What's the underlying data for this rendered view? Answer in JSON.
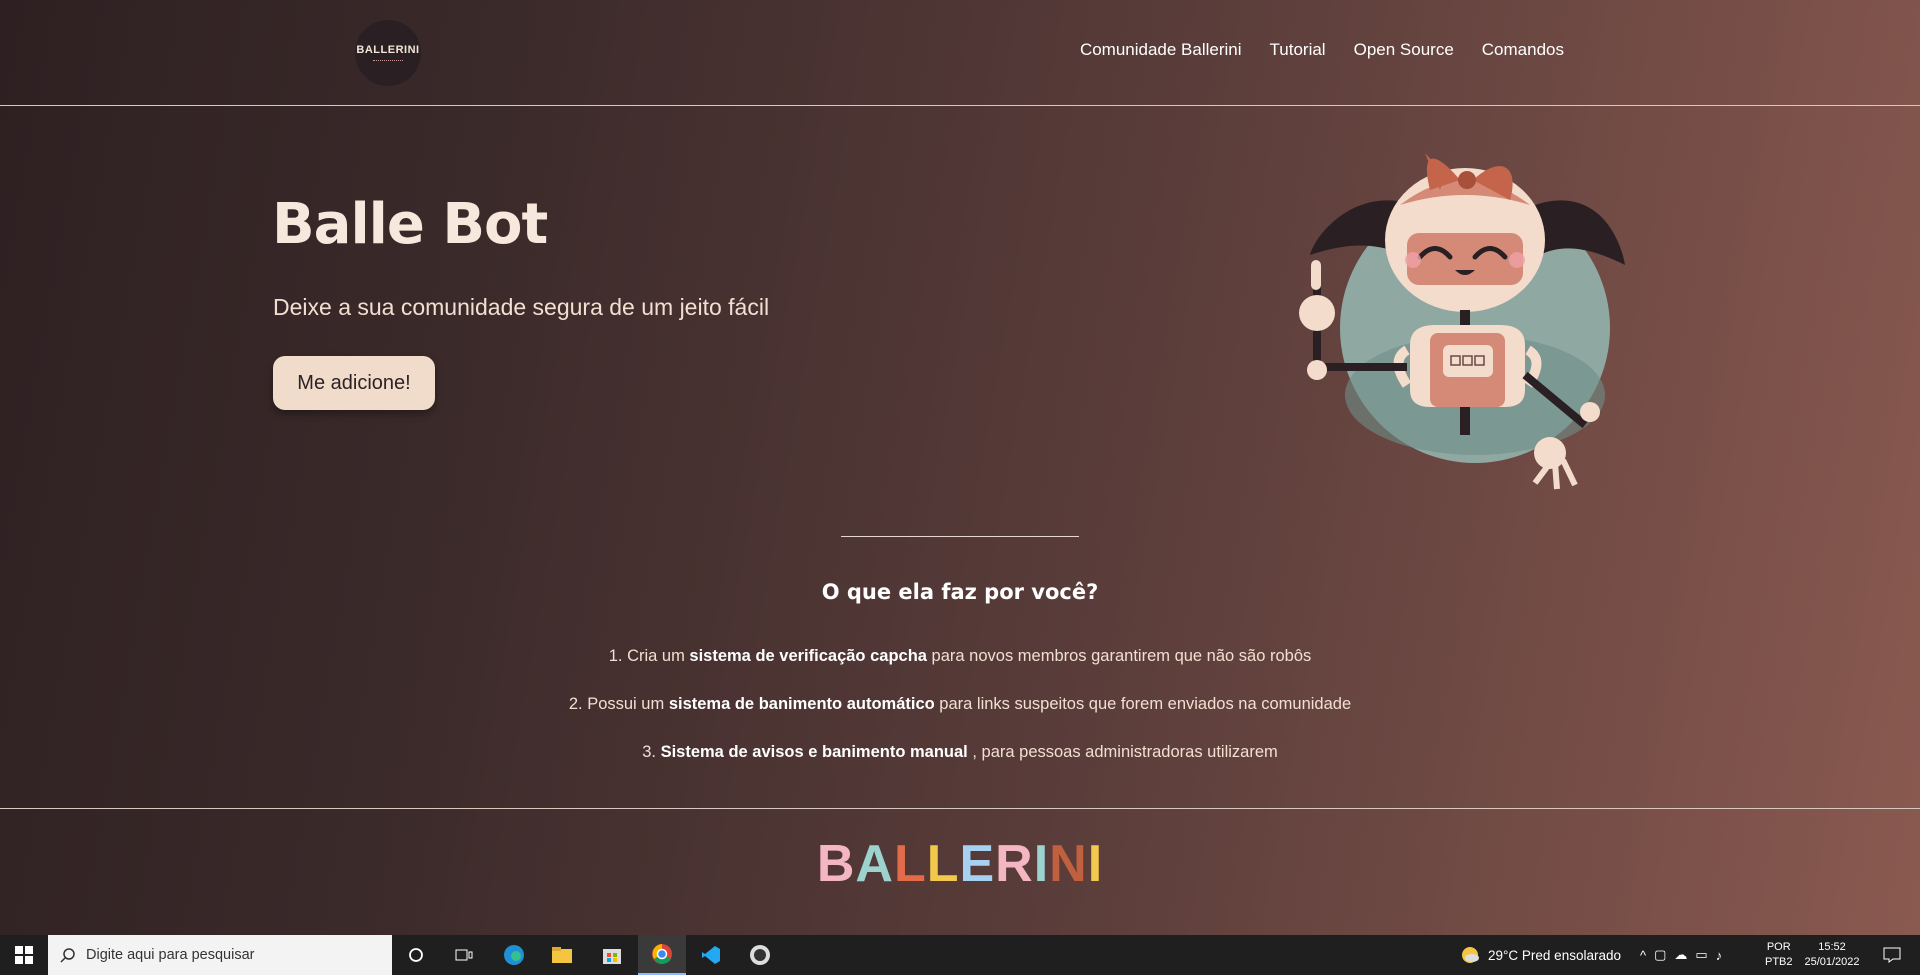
{
  "logo": {
    "text": "BALLERINI"
  },
  "nav": {
    "items": [
      "Comunidade Ballerini",
      "Tutorial",
      "Open Source",
      "Comandos"
    ]
  },
  "hero": {
    "title": "Balle Bot",
    "subtitle": "Deixe a sua comunidade segura de um jeito fácil",
    "button": "Me adicione!"
  },
  "features": {
    "title": "O que ela faz por você?",
    "items": [
      {
        "pre": "1. Cria um ",
        "bold": "sistema de verificação capcha",
        "post": " para novos membros garantirem que não são robôs"
      },
      {
        "pre": "2. Possui um ",
        "bold": "sistema de banimento automático",
        "post": " para links suspeitos que forem enviados na comunidade"
      },
      {
        "pre": "3. ",
        "bold": "Sistema de avisos e banimento manual",
        "post": " , para pessoas administradoras utilizarem"
      }
    ]
  },
  "footer": {
    "brand_letters": [
      "B",
      "A",
      "L",
      "L",
      "E",
      "R",
      "I",
      "N",
      "I"
    ],
    "brand_colors": [
      "#f4b6c2",
      "#9dd3cf",
      "#e36b4a",
      "#f2c94c",
      "#a6d1f0",
      "#f4b6c2",
      "#9dd3cf",
      "#c0603f",
      "#f2c94c"
    ]
  },
  "taskbar": {
    "search_placeholder": "Digite aqui para pesquisar",
    "weather": "29°C  Pred ensolarado",
    "lang_line1": "POR",
    "lang_line2": "PTB2",
    "time": "15:52",
    "date": "25/01/2022",
    "apps": [
      "cortana-icon",
      "task-view-icon",
      "edge-icon",
      "file-explorer-icon",
      "store-icon",
      "chrome-icon",
      "vscode-icon",
      "app-icon"
    ]
  },
  "colors": {
    "accent": "#f1dccc",
    "bg_dark": "#2e2022",
    "bg_light": "#8a5a50"
  }
}
